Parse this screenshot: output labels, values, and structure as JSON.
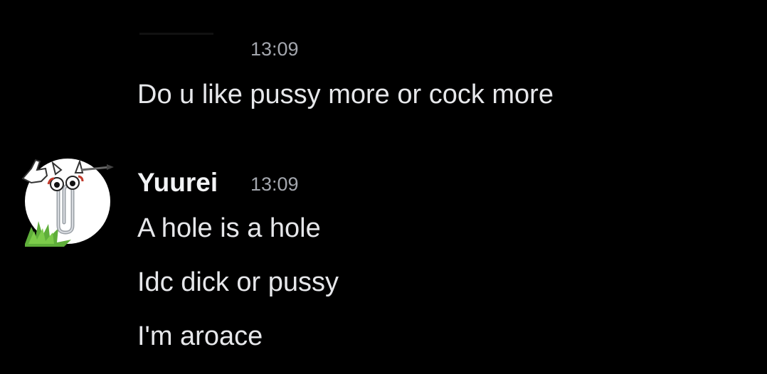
{
  "messages": [
    {
      "timestamp": "13:09",
      "lines": [
        "Do u like pussy more or cock more"
      ]
    },
    {
      "author": "Yuurei",
      "timestamp": "13:09",
      "lines": [
        "A hole is a hole",
        "Idc dick or pussy",
        "I'm aroace"
      ],
      "avatar_icon": "paperclip-mascot-icon"
    }
  ],
  "colors": {
    "background": "#000000",
    "text": "#e6e7ea",
    "timestamp": "#a3a6ad",
    "author": "#f2f3f5"
  }
}
